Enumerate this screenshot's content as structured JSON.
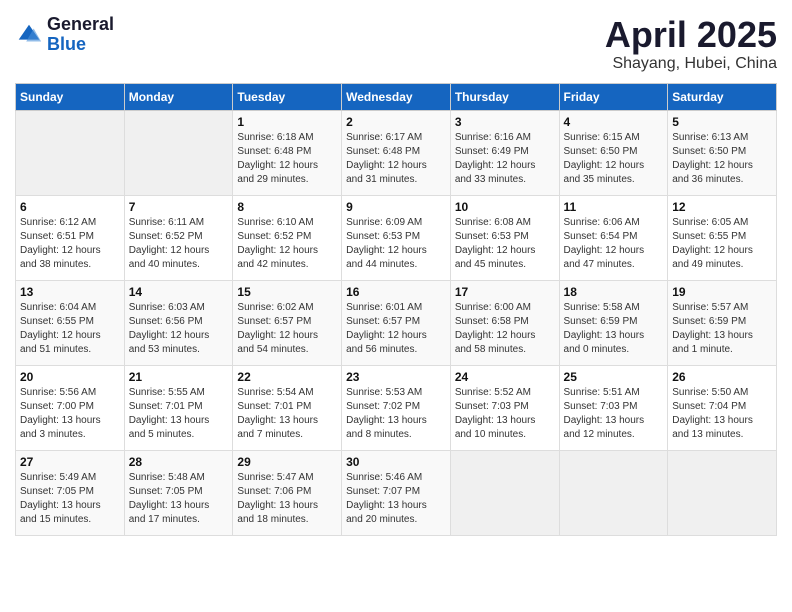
{
  "logo": {
    "general": "General",
    "blue": "Blue"
  },
  "title": "April 2025",
  "location": "Shayang, Hubei, China",
  "days_of_week": [
    "Sunday",
    "Monday",
    "Tuesday",
    "Wednesday",
    "Thursday",
    "Friday",
    "Saturday"
  ],
  "weeks": [
    [
      {
        "day": "",
        "info": ""
      },
      {
        "day": "",
        "info": ""
      },
      {
        "day": "1",
        "info": "Sunrise: 6:18 AM\nSunset: 6:48 PM\nDaylight: 12 hours and 29 minutes."
      },
      {
        "day": "2",
        "info": "Sunrise: 6:17 AM\nSunset: 6:48 PM\nDaylight: 12 hours and 31 minutes."
      },
      {
        "day": "3",
        "info": "Sunrise: 6:16 AM\nSunset: 6:49 PM\nDaylight: 12 hours and 33 minutes."
      },
      {
        "day": "4",
        "info": "Sunrise: 6:15 AM\nSunset: 6:50 PM\nDaylight: 12 hours and 35 minutes."
      },
      {
        "day": "5",
        "info": "Sunrise: 6:13 AM\nSunset: 6:50 PM\nDaylight: 12 hours and 36 minutes."
      }
    ],
    [
      {
        "day": "6",
        "info": "Sunrise: 6:12 AM\nSunset: 6:51 PM\nDaylight: 12 hours and 38 minutes."
      },
      {
        "day": "7",
        "info": "Sunrise: 6:11 AM\nSunset: 6:52 PM\nDaylight: 12 hours and 40 minutes."
      },
      {
        "day": "8",
        "info": "Sunrise: 6:10 AM\nSunset: 6:52 PM\nDaylight: 12 hours and 42 minutes."
      },
      {
        "day": "9",
        "info": "Sunrise: 6:09 AM\nSunset: 6:53 PM\nDaylight: 12 hours and 44 minutes."
      },
      {
        "day": "10",
        "info": "Sunrise: 6:08 AM\nSunset: 6:53 PM\nDaylight: 12 hours and 45 minutes."
      },
      {
        "day": "11",
        "info": "Sunrise: 6:06 AM\nSunset: 6:54 PM\nDaylight: 12 hours and 47 minutes."
      },
      {
        "day": "12",
        "info": "Sunrise: 6:05 AM\nSunset: 6:55 PM\nDaylight: 12 hours and 49 minutes."
      }
    ],
    [
      {
        "day": "13",
        "info": "Sunrise: 6:04 AM\nSunset: 6:55 PM\nDaylight: 12 hours and 51 minutes."
      },
      {
        "day": "14",
        "info": "Sunrise: 6:03 AM\nSunset: 6:56 PM\nDaylight: 12 hours and 53 minutes."
      },
      {
        "day": "15",
        "info": "Sunrise: 6:02 AM\nSunset: 6:57 PM\nDaylight: 12 hours and 54 minutes."
      },
      {
        "day": "16",
        "info": "Sunrise: 6:01 AM\nSunset: 6:57 PM\nDaylight: 12 hours and 56 minutes."
      },
      {
        "day": "17",
        "info": "Sunrise: 6:00 AM\nSunset: 6:58 PM\nDaylight: 12 hours and 58 minutes."
      },
      {
        "day": "18",
        "info": "Sunrise: 5:58 AM\nSunset: 6:59 PM\nDaylight: 13 hours and 0 minutes."
      },
      {
        "day": "19",
        "info": "Sunrise: 5:57 AM\nSunset: 6:59 PM\nDaylight: 13 hours and 1 minute."
      }
    ],
    [
      {
        "day": "20",
        "info": "Sunrise: 5:56 AM\nSunset: 7:00 PM\nDaylight: 13 hours and 3 minutes."
      },
      {
        "day": "21",
        "info": "Sunrise: 5:55 AM\nSunset: 7:01 PM\nDaylight: 13 hours and 5 minutes."
      },
      {
        "day": "22",
        "info": "Sunrise: 5:54 AM\nSunset: 7:01 PM\nDaylight: 13 hours and 7 minutes."
      },
      {
        "day": "23",
        "info": "Sunrise: 5:53 AM\nSunset: 7:02 PM\nDaylight: 13 hours and 8 minutes."
      },
      {
        "day": "24",
        "info": "Sunrise: 5:52 AM\nSunset: 7:03 PM\nDaylight: 13 hours and 10 minutes."
      },
      {
        "day": "25",
        "info": "Sunrise: 5:51 AM\nSunset: 7:03 PM\nDaylight: 13 hours and 12 minutes."
      },
      {
        "day": "26",
        "info": "Sunrise: 5:50 AM\nSunset: 7:04 PM\nDaylight: 13 hours and 13 minutes."
      }
    ],
    [
      {
        "day": "27",
        "info": "Sunrise: 5:49 AM\nSunset: 7:05 PM\nDaylight: 13 hours and 15 minutes."
      },
      {
        "day": "28",
        "info": "Sunrise: 5:48 AM\nSunset: 7:05 PM\nDaylight: 13 hours and 17 minutes."
      },
      {
        "day": "29",
        "info": "Sunrise: 5:47 AM\nSunset: 7:06 PM\nDaylight: 13 hours and 18 minutes."
      },
      {
        "day": "30",
        "info": "Sunrise: 5:46 AM\nSunset: 7:07 PM\nDaylight: 13 hours and 20 minutes."
      },
      {
        "day": "",
        "info": ""
      },
      {
        "day": "",
        "info": ""
      },
      {
        "day": "",
        "info": ""
      }
    ]
  ]
}
